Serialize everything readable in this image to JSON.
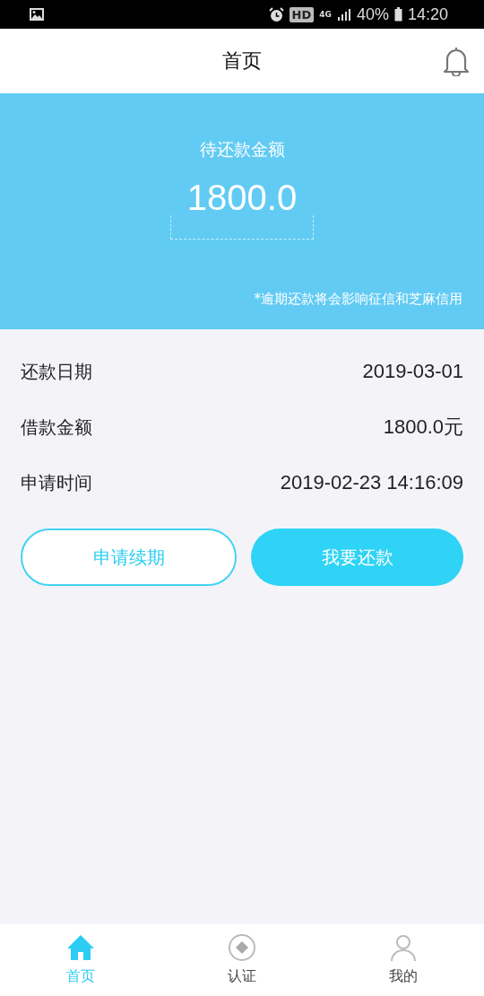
{
  "status_bar": {
    "network": "4G",
    "battery": "40%",
    "time": "14:20",
    "hd": "HD"
  },
  "header": {
    "title": "首页"
  },
  "banner": {
    "label": "待还款金额",
    "amount": "1800.0",
    "note": "*逾期还款将会影响征信和芝麻信用"
  },
  "details": [
    {
      "label": "还款日期",
      "value": "2019-03-01"
    },
    {
      "label": "借款金额",
      "value": "1800.0元"
    },
    {
      "label": "申请时间",
      "value": "2019-02-23 14:16:09"
    }
  ],
  "buttons": [
    {
      "label": "申请续期",
      "kind": "outline"
    },
    {
      "label": "我要还款",
      "kind": "filled"
    }
  ],
  "tabs": [
    {
      "label": "首页",
      "kind": "home",
      "selected": true
    },
    {
      "label": "认证",
      "kind": "verify",
      "selected": false
    },
    {
      "label": "我的",
      "kind": "profile",
      "selected": false
    }
  ]
}
